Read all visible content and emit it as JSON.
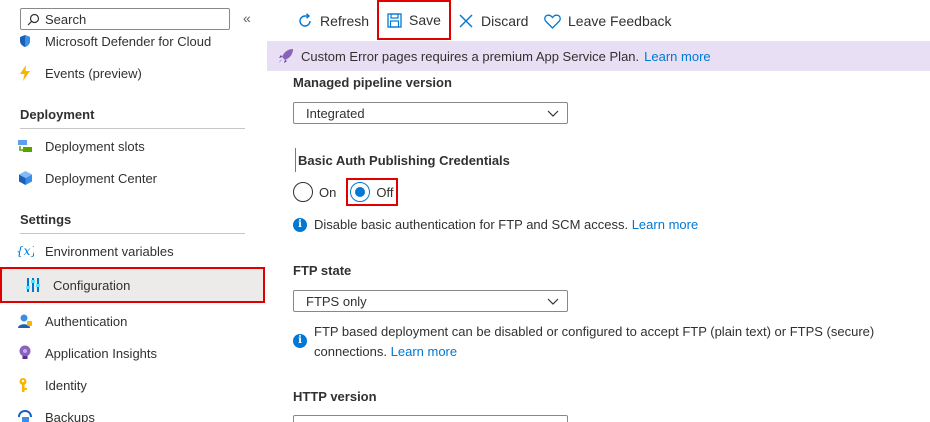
{
  "sidebar": {
    "search_placeholder": "Search",
    "collapse_glyph": "«",
    "items_top": [
      {
        "label": "Microsoft Defender for Cloud",
        "icon": "shield-icon"
      },
      {
        "label": "Events (preview)",
        "icon": "lightning-icon"
      }
    ],
    "sections": [
      {
        "title": "Deployment",
        "items": [
          {
            "label": "Deployment slots",
            "icon": "slots-icon"
          },
          {
            "label": "Deployment Center",
            "icon": "cube-icon"
          }
        ]
      },
      {
        "title": "Settings",
        "items": [
          {
            "label": "Environment variables",
            "icon": "variable-icon"
          },
          {
            "label": "Configuration",
            "icon": "sliders-icon",
            "selected": true
          },
          {
            "label": "Authentication",
            "icon": "person-icon"
          },
          {
            "label": "Application Insights",
            "icon": "bulb-icon"
          },
          {
            "label": "Identity",
            "icon": "key-icon"
          },
          {
            "label": "Backups",
            "icon": "backup-icon"
          }
        ]
      }
    ]
  },
  "toolbar": {
    "refresh": "Refresh",
    "save": "Save",
    "discard": "Discard",
    "feedback": "Leave Feedback"
  },
  "banner": {
    "text": "Custom Error pages requires a premium App Service Plan.",
    "link": "Learn more"
  },
  "settings": {
    "pipeline_label": "Managed pipeline version",
    "pipeline_value": "Integrated",
    "basic_auth_label": "Basic Auth Publishing Credentials",
    "radio_on": "On",
    "radio_off": "Off",
    "basic_auth_info": "Disable basic authentication for FTP and SCM access.",
    "basic_auth_link": "Learn more",
    "ftp_label": "FTP state",
    "ftp_value": "FTPS only",
    "ftp_info_line1": "FTP based deployment can be disabled or configured to accept FTP (plain text) or FTPS (secure)",
    "ftp_info_line2": "connections.",
    "ftp_link": "Learn more",
    "http_label": "HTTP version"
  },
  "colors": {
    "accent": "#0078d4",
    "highlight": "#e00000",
    "banner_bg": "#e8dff5"
  }
}
